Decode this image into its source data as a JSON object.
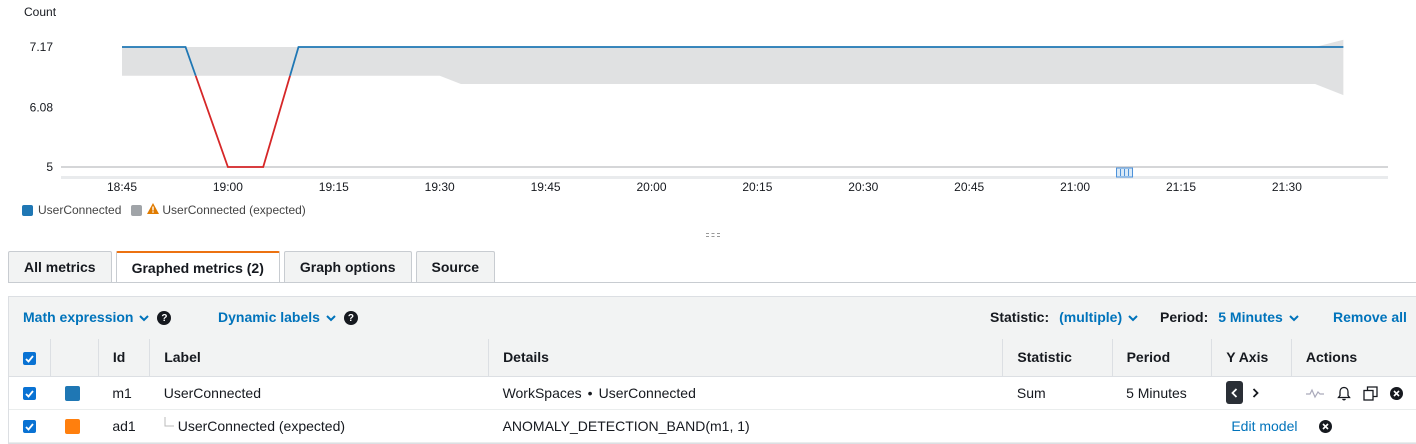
{
  "chart_data": {
    "type": "line",
    "unit_label": "Count",
    "y_ticks": [
      "7.17",
      "6.08",
      "5"
    ],
    "ylim": [
      5,
      7.17
    ],
    "x_ticks": [
      "18:45",
      "19:00",
      "19:15",
      "19:30",
      "19:45",
      "20:00",
      "20:15",
      "20:30",
      "20:45",
      "21:00",
      "21:15",
      "21:30"
    ],
    "series": [
      {
        "name": "UserConnected",
        "color": "#1f77b4",
        "breach_color": "#d62728",
        "x": [
          "18:45",
          "18:54",
          "19:00",
          "19:05",
          "19:10",
          "21:38"
        ],
        "values": [
          7.17,
          7.17,
          5,
          5,
          7.17,
          7.17
        ]
      },
      {
        "name": "UserConnected (expected)",
        "color": "#c7c9cb",
        "warning": true,
        "band_x": [
          "18:45",
          "19:30",
          "19:33",
          "21:34",
          "21:38"
        ],
        "band_upper": [
          7.17,
          7.17,
          7.17,
          7.17,
          7.3
        ],
        "band_lower": [
          6.65,
          6.65,
          6.5,
          6.5,
          6.3
        ]
      }
    ],
    "grid": false
  },
  "tabs": [
    {
      "label": "All metrics",
      "active": false
    },
    {
      "label": "Graphed metrics (2)",
      "active": true
    },
    {
      "label": "Graph options",
      "active": false
    },
    {
      "label": "Source",
      "active": false
    }
  ],
  "toolbar": {
    "math_expression": "Math expression",
    "dynamic_labels": "Dynamic labels",
    "help": "?",
    "statistic_label": "Statistic:",
    "statistic_value": "(multiple)",
    "period_label": "Period:",
    "period_value": "5 Minutes",
    "remove_all": "Remove all"
  },
  "table": {
    "headers": {
      "id": "Id",
      "label": "Label",
      "details": "Details",
      "statistic": "Statistic",
      "period": "Period",
      "y_axis": "Y Axis",
      "actions": "Actions"
    },
    "rows": [
      {
        "id": "m1",
        "label": "UserConnected",
        "details_ns": "WorkSpaces",
        "details_metric": "UserConnected",
        "statistic": "Sum",
        "period": "5 Minutes",
        "color": "#1f77b4"
      },
      {
        "id": "ad1",
        "label": "UserConnected (expected)",
        "details": "ANOMALY_DETECTION_BAND(m1, 1)",
        "statistic": "",
        "period": "",
        "edit_model": "Edit model",
        "color": "#ff7f0e"
      }
    ]
  },
  "colors": {
    "accent": "#ec7211",
    "link": "#0073bb",
    "checkbox": "#0972d3"
  }
}
